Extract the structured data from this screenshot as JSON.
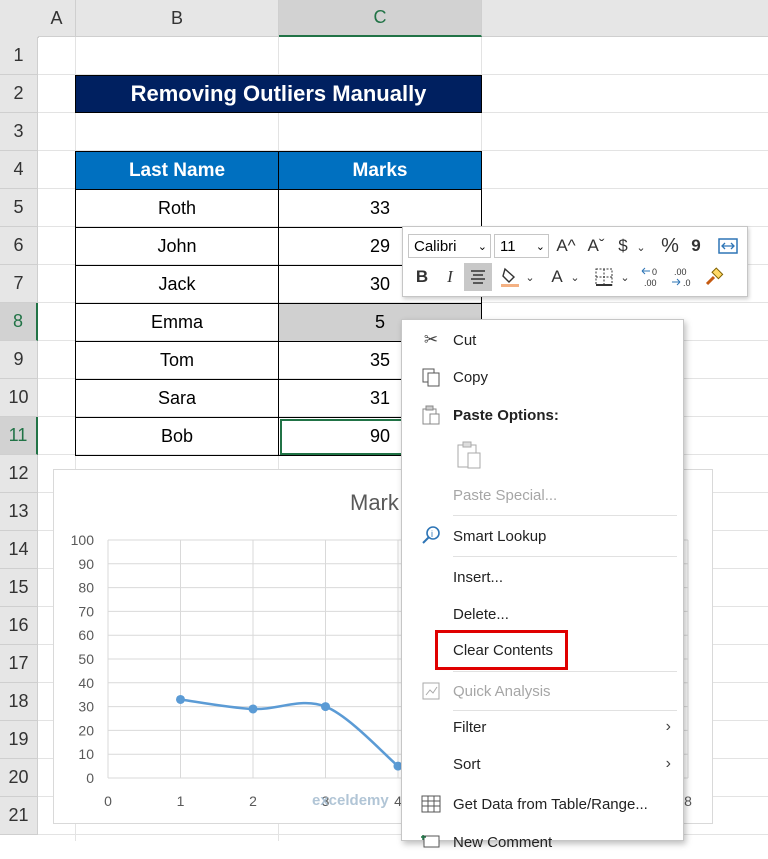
{
  "columns": [
    "A",
    "B",
    "C"
  ],
  "rows": [
    "1",
    "2",
    "3",
    "4",
    "5",
    "6",
    "7",
    "8",
    "9",
    "10",
    "11",
    "12",
    "13",
    "14",
    "15",
    "16",
    "17",
    "18",
    "19",
    "20",
    "21"
  ],
  "title": "Removing Outliers Manually",
  "table": {
    "headers": [
      "Last Name",
      "Marks"
    ],
    "rows": [
      [
        "Roth",
        "33"
      ],
      [
        "John",
        "29"
      ],
      [
        "Jack",
        "30"
      ],
      [
        "Emma",
        "5"
      ],
      [
        "Tom",
        "35"
      ],
      [
        "Sara",
        "31"
      ],
      [
        "Bob",
        "90"
      ]
    ]
  },
  "chart_data": {
    "type": "line",
    "title": "Mark",
    "x": [
      1,
      2,
      3,
      4
    ],
    "values": [
      33,
      29,
      30,
      5
    ],
    "ylim": [
      0,
      100
    ],
    "yticks": [
      "0",
      "10",
      "20",
      "30",
      "40",
      "50",
      "60",
      "70",
      "80",
      "90",
      "100"
    ],
    "xticks": [
      "0",
      "1",
      "2",
      "3",
      "4",
      "8"
    ],
    "grid": true,
    "line_color": "#5b9bd5"
  },
  "minitoolbar": {
    "font": "Calibri",
    "size": "11",
    "bold": "B",
    "italic": "I",
    "font_color_label": "A",
    "increase_font": "A^",
    "decrease_font": "Aˇ",
    "currency": "$",
    "percent": "%",
    "comma": "9"
  },
  "menu": {
    "cut": "Cut",
    "copy": "Copy",
    "paste_options": "Paste Options:",
    "paste_special": "Paste Special...",
    "smart_lookup": "Smart Lookup",
    "insert": "Insert...",
    "delete": "Delete...",
    "clear_contents": "Clear Contents",
    "quick_analysis": "Quick Analysis",
    "filter": "Filter",
    "sort": "Sort",
    "get_data": "Get Data from Table/Range...",
    "new_comment": "New Comment"
  },
  "watermark": "exceldemy",
  "colors": {
    "title_bg": "#002060",
    "header_bg": "#0070c0",
    "selection": "#217346",
    "highlight_box": "#e00000"
  }
}
